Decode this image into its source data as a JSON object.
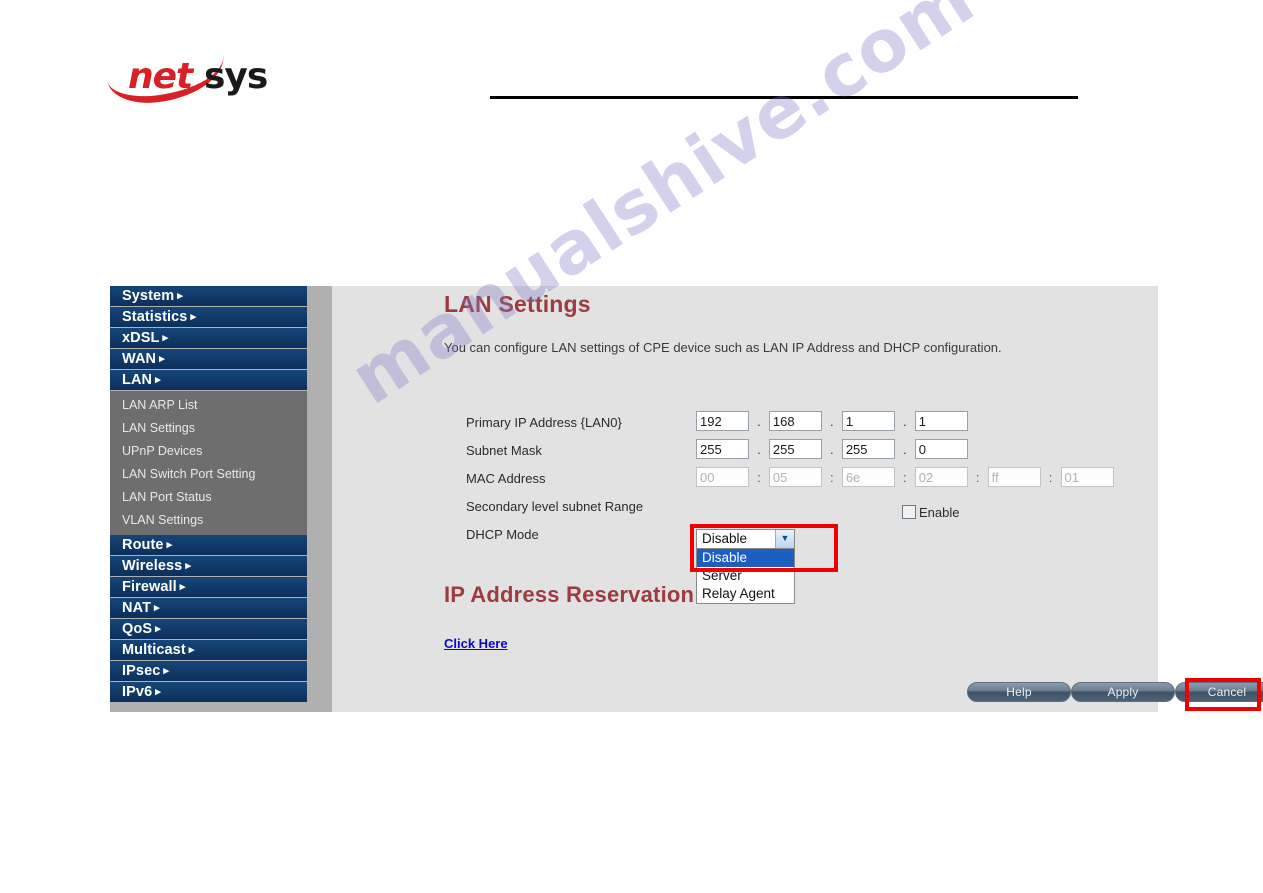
{
  "header": {
    "logo_net": "net",
    "logo_sys": "sys"
  },
  "watermark": {
    "text": "manualshive.com"
  },
  "sidebar": {
    "top_items": [
      {
        "label": "System",
        "chevron": "▸"
      },
      {
        "label": "Statistics",
        "chevron": "▸"
      },
      {
        "label": "xDSL",
        "chevron": "▸"
      },
      {
        "label": "WAN",
        "chevron": "▸"
      },
      {
        "label": "LAN",
        "chevron": "▸"
      }
    ],
    "lan_submenu": [
      {
        "label": "LAN ARP List"
      },
      {
        "label": "LAN Settings"
      },
      {
        "label": "UPnP Devices"
      },
      {
        "label": "LAN Switch Port Setting"
      },
      {
        "label": "LAN Port Status"
      },
      {
        "label": "VLAN Settings"
      }
    ],
    "bottom_items": [
      {
        "label": "Route",
        "chevron": "▸"
      },
      {
        "label": "Wireless",
        "chevron": "▸"
      },
      {
        "label": "Firewall",
        "chevron": "▸"
      },
      {
        "label": "NAT",
        "chevron": "▸"
      },
      {
        "label": "QoS",
        "chevron": "▸"
      },
      {
        "label": "Multicast",
        "chevron": "▸"
      },
      {
        "label": "IPsec",
        "chevron": "▸"
      },
      {
        "label": "IPv6",
        "chevron": "▸"
      }
    ]
  },
  "content": {
    "title": "LAN Settings",
    "description": "You can configure LAN settings of CPE device such as LAN IP Address and DHCP configuration.",
    "fields": {
      "primary_ip": {
        "label": "Primary IP Address {LAN0}",
        "octets": [
          "192",
          "168",
          "1",
          "1"
        ],
        "separator": "."
      },
      "subnet_mask": {
        "label": "Subnet Mask",
        "octets": [
          "255",
          "255",
          "255",
          "0"
        ],
        "separator": "."
      },
      "mac_address": {
        "label": "MAC Address",
        "octets": [
          "00",
          "05",
          "6e",
          "02",
          "ff",
          "01"
        ],
        "separator": ":"
      },
      "secondary_subnet": {
        "label": "Secondary level subnet Range",
        "enable_label": "Enable",
        "enabled": false
      },
      "dhcp_mode": {
        "label": "DHCP Mode",
        "selected": "Disable",
        "options": [
          "Disable",
          "Server",
          "Relay Agent"
        ],
        "arrow": "▼"
      }
    },
    "reservation": {
      "title": "IP Address Reservation",
      "link_label": "Click Here"
    },
    "buttons": {
      "help": "Help",
      "apply": "Apply",
      "cancel": "Cancel"
    }
  },
  "colors": {
    "nav_blue": "#0f3a6b",
    "submenu_gray": "#6e6e6e",
    "title_maroon": "#9d3b41",
    "highlight_red": "#f00000",
    "link_blue": "#0a0ac8",
    "select_highlight": "#1d5fc0"
  }
}
